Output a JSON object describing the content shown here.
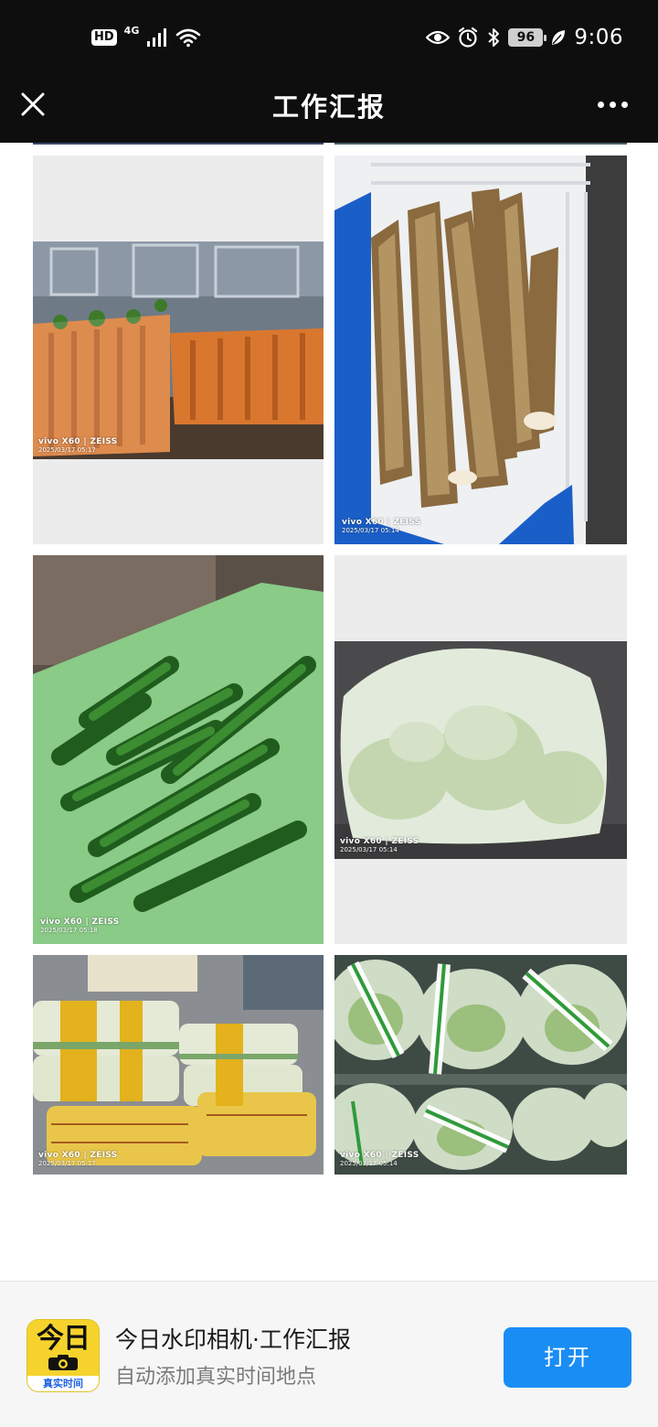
{
  "status_bar": {
    "hd_badge": "HD",
    "network": "4G",
    "battery": "96",
    "time": "9:06",
    "icons": [
      "signal-icon",
      "wifi-icon",
      "eye-icon",
      "alarm-icon",
      "bluetooth-icon",
      "battery-icon",
      "leaf-icon"
    ]
  },
  "header": {
    "title": "工作汇报",
    "close_icon": "close-icon",
    "more_icon": "more-icon"
  },
  "photos": [
    {
      "subject": "carrots",
      "watermark_brand": "vivo X60 | ZEISS",
      "watermark_date": "2025/03/17 05:17"
    },
    {
      "subject": "yams",
      "watermark_brand": "vivo X60 | ZEISS",
      "watermark_date": "2025/03/17 05:14"
    },
    {
      "subject": "green peppers",
      "watermark_brand": "vivo X60 | ZEISS",
      "watermark_date": "2025/03/17 05:18"
    },
    {
      "subject": "cabbage",
      "watermark_brand": "vivo X60 | ZEISS",
      "watermark_date": "2025/03/17 05:14"
    },
    {
      "subject": "napa cabbage",
      "watermark_brand": "vivo X60 | ZEISS",
      "watermark_date": "2025/03/17 05:17"
    },
    {
      "subject": "bagged greens",
      "watermark_brand": "vivo X60 | ZEISS",
      "watermark_date": "2025/03/17 05:14"
    }
  ],
  "banner": {
    "app_icon_text": "今日",
    "app_icon_tag": "真实时间",
    "title": "今日水印相机·工作汇报",
    "subtitle": "自动添加真实时间地点",
    "open_button": "打开"
  },
  "colors": {
    "top_bar": "#0e0e0e",
    "open_button": "#1a8df5",
    "app_icon": "#f5d32c",
    "image_placeholder": "#ececec"
  }
}
